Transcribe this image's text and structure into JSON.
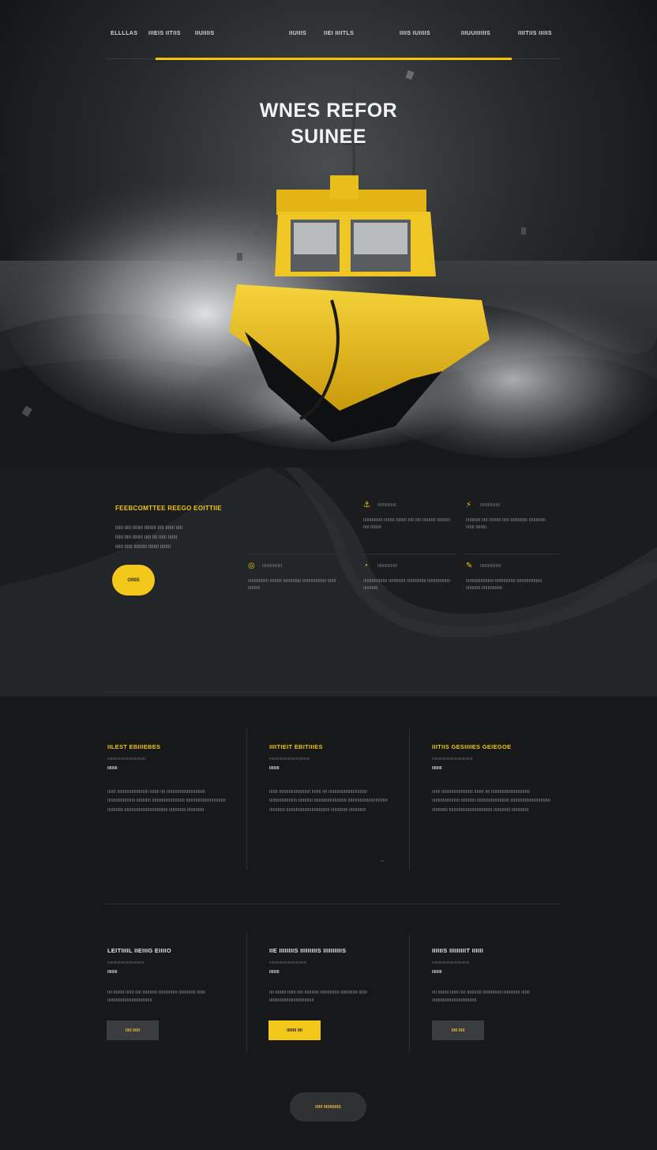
{
  "nav": {
    "items": [
      "ELLLLAS",
      "IIIEIS IITIIS",
      "IIUIIIIS",
      "IIUIIIS",
      "IIEI IIIITLS",
      "IIIIS IUIIIIS",
      "IIIUUIIIIIIS",
      "IIIITIIS IIIIIS"
    ]
  },
  "hero": {
    "title_line1": "WNES REFOR",
    "title_line2": "SUINEE"
  },
  "features": {
    "title": "FEEBCOMTTEE REEGO EOITTIIE",
    "text_lines": [
      "IIIIII IIIII IIIIIIII IIIIIIIII IIIII IIIIIII IIIII",
      "IIIIII IIIII IIIIIIII IIIII IIII IIIIII IIIIIII",
      "IIIIII IIIIII IIIIIIIIII IIIIIIII IIIIIIII"
    ],
    "button_label": "OIIIIS",
    "services": [
      {
        "icon": "anchor-icon",
        "label": "IIIIIIIIIIIIIIIII",
        "text": "IIIIIIIIIIIIIIII IIIIIIIII IIIIIIIII IIIII IIIII IIIIIIIIIII IIIIIIIIIII IIIII IIIIIIIII"
      },
      {
        "icon": "speed-icon",
        "label": "IIIIIIIIIIIIIIIIII",
        "text": "IIIIIIIIIIII IIIII IIIIIIIIII IIIIII IIIIIIIIIIIIII IIIIIIIIIIIIII IIIIIII IIIIIIIII"
      },
      {
        "icon": "lifebuoy-icon",
        "label": "IIIIIIIIIIIIIIIIII",
        "text": "IIIIIIIIIIIIIIIII IIIIIIIIII IIIIIIIIIIIIIII IIIIIIIIIIIIIIIIIIII IIIIIII IIIIIIIIII"
      },
      {
        "icon": "gauge-icon",
        "label": "IIIIIIIIIIIIIIIIII",
        "text": "IIIIIIIIIIIIIIIIIIII IIIIIIIIIIIIII IIIIIIIIIIIIIIII IIIIIIIIIIIIIIIIIII IIIIIIIIIIII"
      },
      {
        "icon": "wrench-icon",
        "label": "IIIIIIIIIIIIIIIIIII",
        "text": "IIIIIIIIIIIIIIIIIIIIIII IIIIIIIIIIIIIIIII IIIIIIIIIIIIIIIIIIIII IIIIIIIIIIII IIIIIIIIIIIIIIIII"
      }
    ]
  },
  "columns": [
    {
      "title": "IILEST EBIIIEBES",
      "sub": "IIIIIIIIIIIIIIIIIIIIIIIIIIIIIIIIIIIIIII",
      "tag": "IIIIIIIII",
      "body": "IIIIIII IIIIIIIIIIIIIIIIIIIIIIIIII IIIIIIII IIII IIIIIIIIIIIIIIIIIIIIIIIIIIIIIIII IIIIIIIIIIIIIIIIIIIIIII IIIIIIIIIIII IIIIIIIIIIIIIIIIIIIIIIIIIII IIIIIIIIIIIIIIIIIIIIIIIIIIIIIIIII IIIIIIIIIIIII IIIIIIIIIIIIIIIIIIIIIIIIIIIIIIIIIIII IIIIIIIIIIIIII IIIIIIIIIIIIII"
    },
    {
      "title": "IIIITIEIT EBITIIIES",
      "sub": "IIIIIIIIIIIIIIIIIIIIIIIIIIIIIIIIIIIIIIIII",
      "tag": "IIIIIIIII",
      "body": "IIIIIII IIIIIIIIIIIIIIIIIIIIIIIIII IIIIIIII IIII IIIIIIIIIIIIIIIIIIIIIIIIIIIIIIII IIIIIIIIIIIIIIIIIIIIIII IIIIIIIIIIII IIIIIIIIIIIIIIIIIIIIIIIIIII IIIIIIIIIIIIIIIIIIIIIIIIIIIIIIIII IIIIIIIIIIIII IIIIIIIIIIIIIIIIIIIIIIIIIIIIIIIIIIII IIIIIIIIIIIIII IIIIIIIIIIIIII"
    },
    {
      "title": "IIITIIS GESIIIIES GEIEGOE",
      "sub": "IIIIIIIIIIIIIIIIIIIIIIIIIIIIIIIIIIIIIIIII",
      "tag": "IIIIIIIII",
      "body": "IIIIIII IIIIIIIIIIIIIIIIIIIIIIIIII IIIIIIII IIII IIIIIIIIIIIIIIIIIIIIIIIIIIIIIIII IIIIIIIIIIIIIIIIIIIIIII IIIIIIIIIIII IIIIIIIIIIIIIIIIIIIIIIIIIII IIIIIIIIIIIIIIIIIIIIIIIIIIIIIIIII IIIIIIIIIIIII IIIIIIIIIIIIIIIIIIIIIIIIIIIIIIIIIIII IIIIIIIIIIIIII IIIIIIIIIIIIII"
    }
  ],
  "cards": [
    {
      "title": "LEITIIIIL IIEIIIG EIIIIO",
      "sub": "IIIIIIIIIIIIIIIIIIIIIIIIIIIIIIIIIIIII",
      "tag": "IIIIIIIII",
      "body": "IIII IIIIIIIII IIIIIII IIIII IIIIIIIIIIII IIIIIIIIIIIIIIII IIIIIIIIIIIIII IIIIIII IIIIIIIIIIIIIIIIIIIIIIIIIIIIIIIIIIIII",
      "button": "IIIII IIIIII"
    },
    {
      "title": "IIE IIIIIIIIS IIIIIIIIIS IIIIIIIIIIS",
      "sub": "IIIIIIIIIIIIIIIIIIIIIIIIIIIIIIIIIIIIII",
      "tag": "IIIIIIIII",
      "body": "IIII IIIIIIIII IIIIIII IIIII IIIIIIIIIIII IIIIIIIIIIIIIIII IIIIIIIIIIIIII IIIIIII IIIIIIIIIIIIIIIIIIIIIIIIIIIIIIIIIIIII",
      "button": "IIIIIIII IIII"
    },
    {
      "title": "IIIIIIS IIIIIIIIIT IIIIII",
      "sub": "IIIIIIIIIIIIIIIIIIIIIIIIIIIIIIIIIIIIII",
      "tag": "IIIIIIIII",
      "body": "IIII IIIIIIIII IIIIIII IIIII IIIIIIIIIIII IIIIIIIIIIIIIIII IIIIIIIIIIIIII IIIIIII IIIIIIIIIIIIIIIIIIIIIIIIIIIIIIIIIIIII",
      "button": "IIIII IIIII"
    }
  ],
  "footer": {
    "button_label": "IIIIII IIIIIIIIIIIIS"
  },
  "colors": {
    "accent": "#f1c40f",
    "background": "#161819",
    "boat_hull": "#e8b816"
  }
}
